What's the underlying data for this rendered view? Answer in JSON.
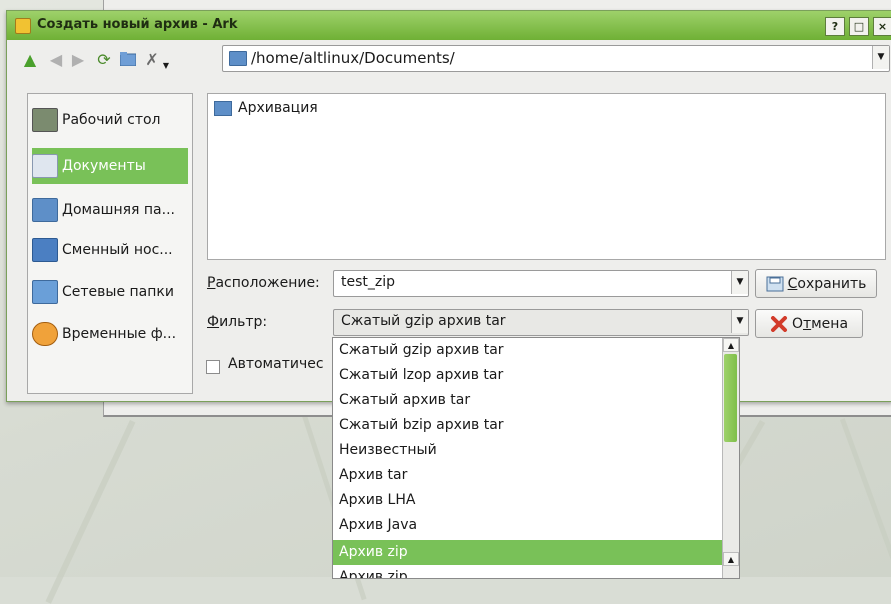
{
  "window": {
    "title": "Создать новый архив - Ark",
    "help_label": "?",
    "maximize_label": "□",
    "close_label": "×"
  },
  "toolbar": {
    "path": "/home/altlinux/Documents/"
  },
  "places": [
    {
      "label": "Рабочий стол"
    },
    {
      "label": "Документы"
    },
    {
      "label": "Домашняя па..."
    },
    {
      "label": "Сменный нос..."
    },
    {
      "label": "Сетевые папки"
    },
    {
      "label": "Временные ф..."
    }
  ],
  "files": [
    {
      "name": "Архивация"
    }
  ],
  "location": {
    "label_accel": "Р",
    "label_rest": "асположение:",
    "value": "test_zip"
  },
  "filter": {
    "label_accel": "Ф",
    "label_rest": "ильтр:",
    "value": "Сжатый gzip архив tar"
  },
  "buttons": {
    "save_accel": "С",
    "save_rest": "охранить",
    "cancel_prefix": "О",
    "cancel_accel": "т",
    "cancel_rest": "мена"
  },
  "auto_checkbox_label": "Автоматичес",
  "filter_options": [
    "Сжатый gzip архив tar",
    "Сжатый lzop архив tar",
    "Сжатый архив tar",
    "Сжатый bzip архив tar",
    "Неизвестный",
    "Архив tar",
    "Архив LHA",
    "Архив Java",
    "Архив zip",
    "Архив zip"
  ],
  "selected_filter_option": "Архив zip",
  "colors": {
    "accent": "#79c158",
    "title_bar": "#6fb035"
  }
}
